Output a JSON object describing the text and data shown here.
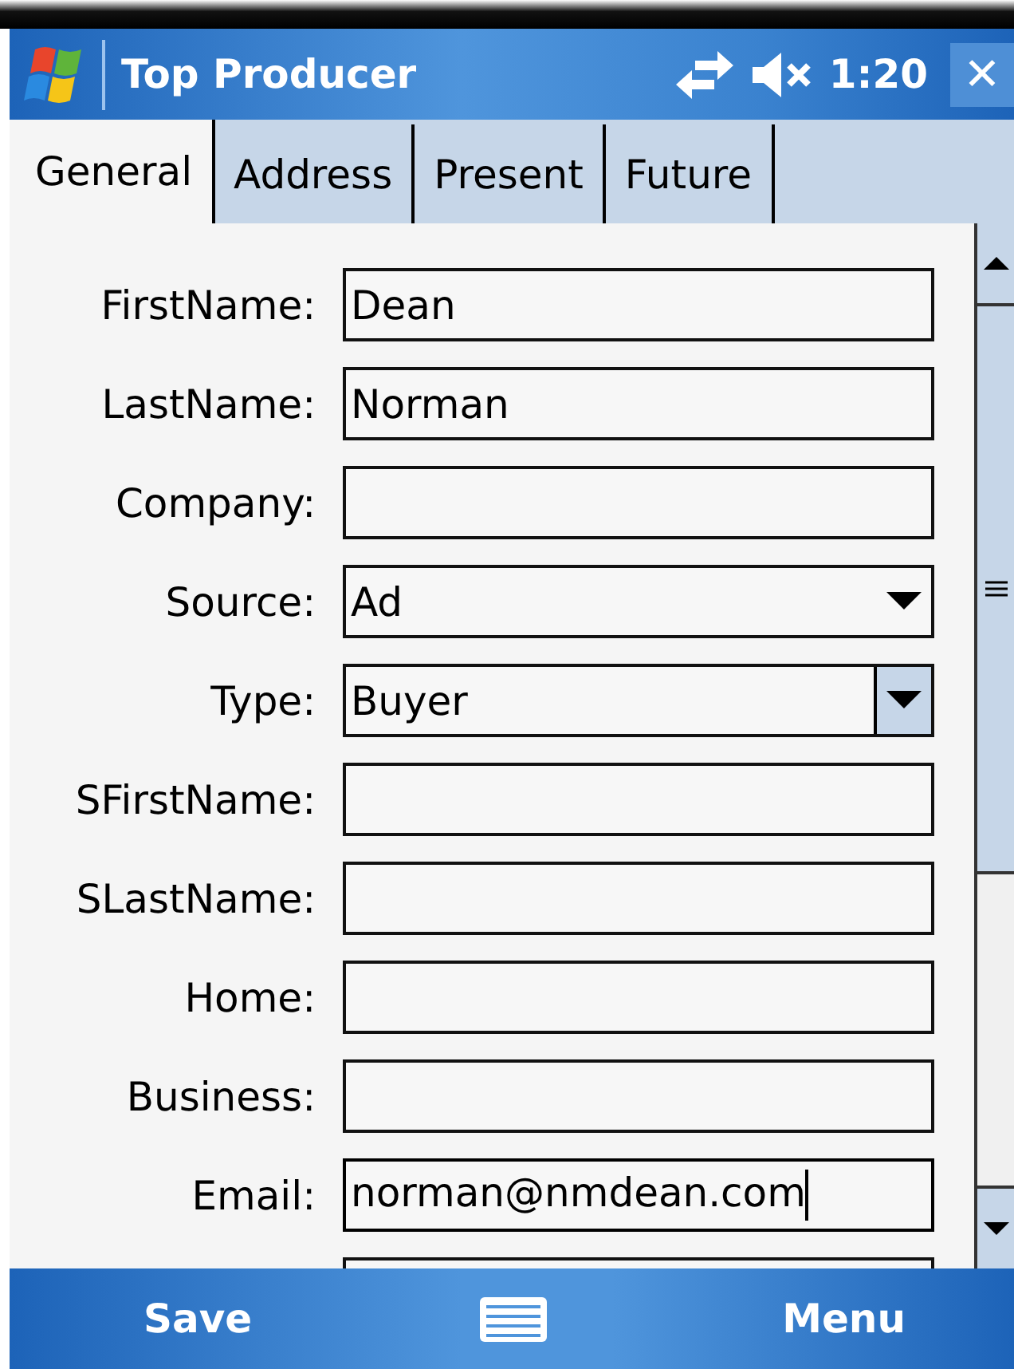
{
  "title_bar": {
    "title": "Top Producer",
    "time": "1:20",
    "muted": true,
    "close": "✕"
  },
  "tabs": [
    {
      "label": "General",
      "selected": true
    },
    {
      "label": "Address",
      "selected": false
    },
    {
      "label": "Present",
      "selected": false
    },
    {
      "label": "Future",
      "selected": false
    }
  ],
  "fields": [
    {
      "label": "FirstName:",
      "kind": "text",
      "value": "Dean",
      "focused": false
    },
    {
      "label": "LastName:",
      "kind": "text",
      "value": "Norman",
      "focused": false
    },
    {
      "label": "Company:",
      "kind": "text",
      "focused": false
    },
    {
      "label": "Source:",
      "kind": "dropdown",
      "value": "Ad",
      "focused": false
    },
    {
      "label": "Type:",
      "kind": "combo",
      "value": "Buyer",
      "focused": false
    },
    {
      "label": "SFirstName:",
      "kind": "text",
      "focused": false
    },
    {
      "label": "SLastName:",
      "kind": "text",
      "focused": false
    },
    {
      "label": "Home:",
      "kind": "text",
      "focused": false
    },
    {
      "label": "Business:",
      "kind": "text",
      "focused": false
    },
    {
      "label": "Email:",
      "kind": "text",
      "value": "norman@nmdean.com",
      "focused": true
    },
    {
      "kind": "text",
      "focused": false
    }
  ],
  "soft_keys": {
    "left": "Save",
    "right": "Menu"
  }
}
